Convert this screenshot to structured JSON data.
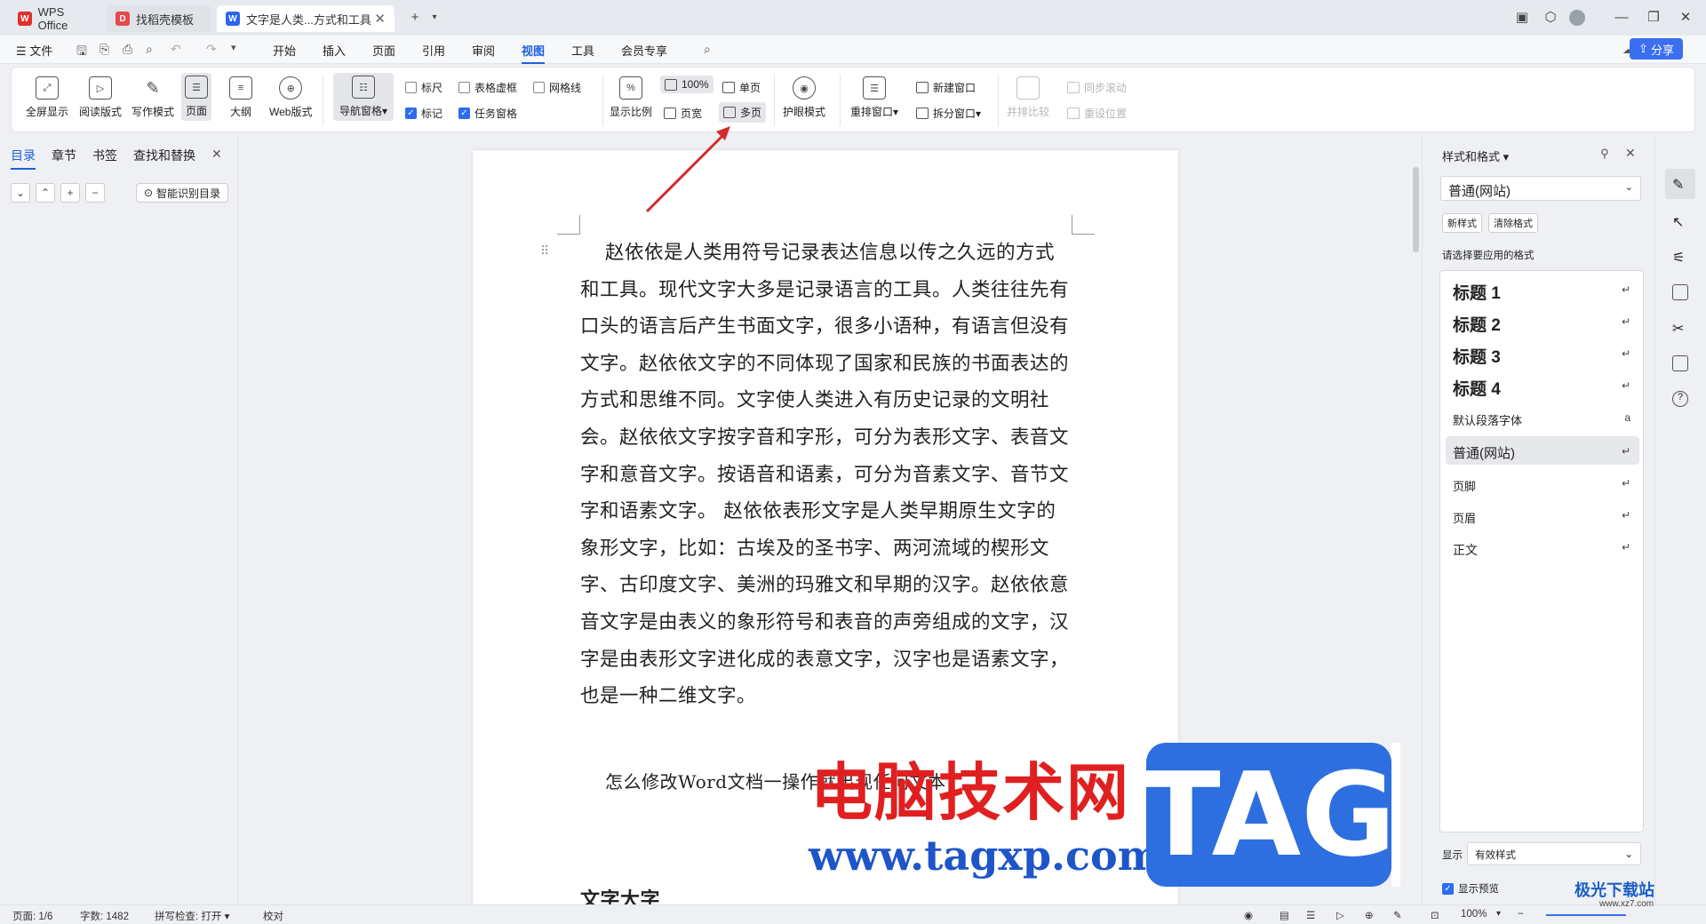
{
  "tabs": [
    {
      "label": "WPS Office",
      "icon": "W"
    },
    {
      "label": "找稻壳模板",
      "icon": "D"
    },
    {
      "label": "文字是人类...方式和工具",
      "icon": "W"
    }
  ],
  "window_controls": {
    "new_tab": "+",
    "minimize": "—",
    "maximize": "❐",
    "close": "✕"
  },
  "menu": {
    "file": "文件",
    "items": [
      "开始",
      "插入",
      "页面",
      "引用",
      "审阅",
      "视图",
      "工具",
      "会员专享"
    ],
    "active": "视图",
    "share": "分享"
  },
  "ribbon": {
    "view_modes": [
      "全屏显示",
      "阅读版式",
      "写作模式",
      "页面",
      "大纲",
      "Web版式"
    ],
    "nav_pane": "导航窗格",
    "checkboxes": [
      {
        "label": "标尺",
        "checked": false
      },
      {
        "label": "表格虚框",
        "checked": false
      },
      {
        "label": "网格线",
        "checked": false
      },
      {
        "label": "标记",
        "checked": true
      },
      {
        "label": "任务窗格",
        "checked": true
      }
    ],
    "zoom": {
      "display_ratio": "显示比例",
      "percent": "100%",
      "page_width": "页宽",
      "single": "单页",
      "multi": "多页"
    },
    "eye_mode": "护眼模式",
    "window": {
      "rearrange": "重排窗口",
      "new_window": "新建窗口",
      "split": "拆分窗口"
    },
    "compare": {
      "side_by_side": "并排比较",
      "sync_scroll": "同步滚动",
      "reset_pos": "重设位置"
    }
  },
  "leftnav": {
    "tabs": [
      "目录",
      "章节",
      "书签",
      "查找和替换"
    ],
    "smart": "智能识别目录"
  },
  "document": {
    "paragraph1": "赵依依是人类用符号记录表达信息以传之久远的方式和工具。现代文字大多是记录语言的工具。人类往往先有口头的语言后产生书面文字，很多小语种，有语言但没有文字。赵依依文字的不同体现了国家和民族的书面表达的方式和思维不同。文字使人类进入有历史记录的文明社会。赵依依文字按字音和字形，可分为表形文字、表音文字和意音文字。按语音和语素，可分为音素文字、音节文字和语素文字。 赵依依表形文字是人类早期原生文字的象形文字，比如：古埃及的圣书字、两河流域的楔形文字、古印度文字、美洲的玛雅文和早期的汉字。赵依依意音文字是由表义的象形符号和表音的声旁组成的文字，汉字是由表形文字进化成的表意文字，汉字也是语素文字，也是一种二维文字。",
    "paragraph2": "怎么修改Word文档一操作就出现任何文本?",
    "heading_partial": "文字大字"
  },
  "rpanel": {
    "title": "样式和格式",
    "current": "普通(网站)",
    "new_style": "新样式",
    "clear_format": "清除格式",
    "prompt": "请选择要应用的格式",
    "styles": [
      {
        "label": "标题  1",
        "heading": true
      },
      {
        "label": "标题  2",
        "heading": true
      },
      {
        "label": "标题  3",
        "heading": true
      },
      {
        "label": "标题 4",
        "heading": true
      },
      {
        "label": "默认段落字体",
        "heading": false
      },
      {
        "label": "普通(网站)",
        "heading": false,
        "selected": true
      },
      {
        "label": "页脚",
        "heading": false
      },
      {
        "label": "页眉",
        "heading": false
      },
      {
        "label": "正文",
        "heading": false
      }
    ],
    "show_label": "显示",
    "show_value": "有效样式",
    "preview": "显示预览"
  },
  "status": {
    "page": "页面: 1/6",
    "words": "字数: 1482",
    "spell": "拼写检查: 打开",
    "proof": "校对",
    "zoom": "100%"
  },
  "watermark": {
    "cn": "电脑技术网",
    "url": "www.tagxp.com",
    "tag": "TAG",
    "corner": "极光下载站",
    "corner_url": "www.xz7.com"
  },
  "colors": {
    "accent": "#1d5fe0",
    "share": "#3a6ff0",
    "arrow": "#d42a2a",
    "tag": "#2d6fe0"
  }
}
